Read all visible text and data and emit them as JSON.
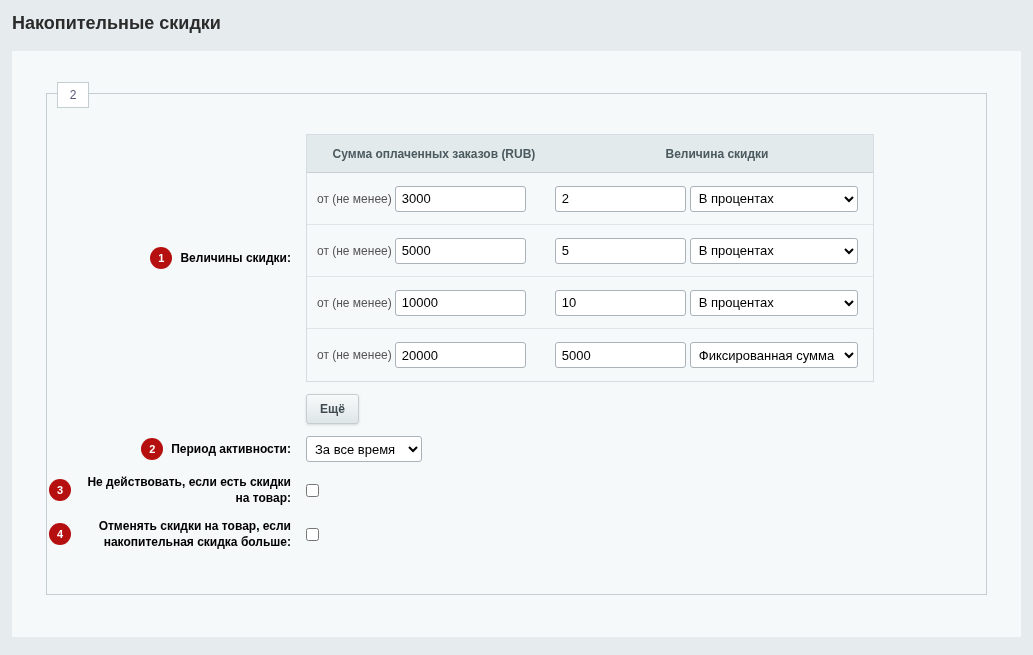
{
  "page_title": "Накопительные скидки",
  "fieldset": {
    "legend": "2"
  },
  "discounts": {
    "badge": "1",
    "label": "Величины скидки:",
    "columns": [
      "Сумма оплаченных заказов (RUB)",
      "Величина скидки"
    ],
    "rows": [
      {
        "prefix": "от (не менее)",
        "amount": "3000",
        "value": "2",
        "type": "В процентах"
      },
      {
        "prefix": "от (не менее)",
        "amount": "5000",
        "value": "5",
        "type": "В процентах"
      },
      {
        "prefix": "от (не менее)",
        "amount": "10000",
        "value": "10",
        "type": "В процентах"
      },
      {
        "prefix": "от (не менее)",
        "amount": "20000",
        "value": "5000",
        "type": "Фиксированная сумма"
      }
    ],
    "more_button": "Ещё"
  },
  "period": {
    "badge": "2",
    "label": "Период активности:",
    "value": "За все время"
  },
  "options": [
    {
      "badge": "3",
      "label": "Не действовать, если есть скидки на товар:",
      "checked": false
    },
    {
      "badge": "4",
      "label": "Отменять скидки на товар, если накопительная скидка больше:",
      "checked": false
    }
  ]
}
